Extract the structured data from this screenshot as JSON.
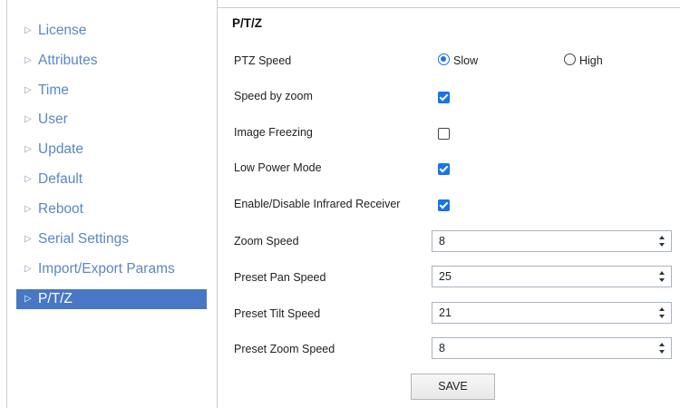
{
  "sidebar": {
    "items": [
      {
        "label": "License"
      },
      {
        "label": "Attributes"
      },
      {
        "label": "Time"
      },
      {
        "label": "User"
      },
      {
        "label": "Update"
      },
      {
        "label": "Default"
      },
      {
        "label": "Reboot"
      },
      {
        "label": "Serial Settings"
      },
      {
        "label": "Import/Export Params"
      },
      {
        "label": "P/T/Z",
        "active": true
      }
    ]
  },
  "section": {
    "title": "P/T/Z"
  },
  "form": {
    "ptz_speed": {
      "label": "PTZ Speed",
      "options": [
        "Slow",
        "High"
      ],
      "selected": "Slow"
    },
    "speed_by_zoom": {
      "label": "Speed by zoom",
      "checked": true
    },
    "image_freezing": {
      "label": "Image Freezing",
      "checked": false
    },
    "low_power_mode": {
      "label": "Low Power Mode",
      "checked": true
    },
    "infrared_receiver": {
      "label": "Enable/Disable Infrared Receiver",
      "checked": true
    },
    "zoom_speed": {
      "label": "Zoom Speed",
      "value": "8"
    },
    "preset_pan_speed": {
      "label": "Preset Pan Speed",
      "value": "25"
    },
    "preset_tilt_speed": {
      "label": "Preset Tilt Speed",
      "value": "21"
    },
    "preset_zoom_speed": {
      "label": "Preset Zoom Speed",
      "value": "8"
    }
  },
  "actions": {
    "save_label": "SAVE"
  },
  "colors": {
    "accent": "#1a73e8",
    "sidebar_active_bg": "#4878c5",
    "sidebar_link": "#5b87c4"
  }
}
